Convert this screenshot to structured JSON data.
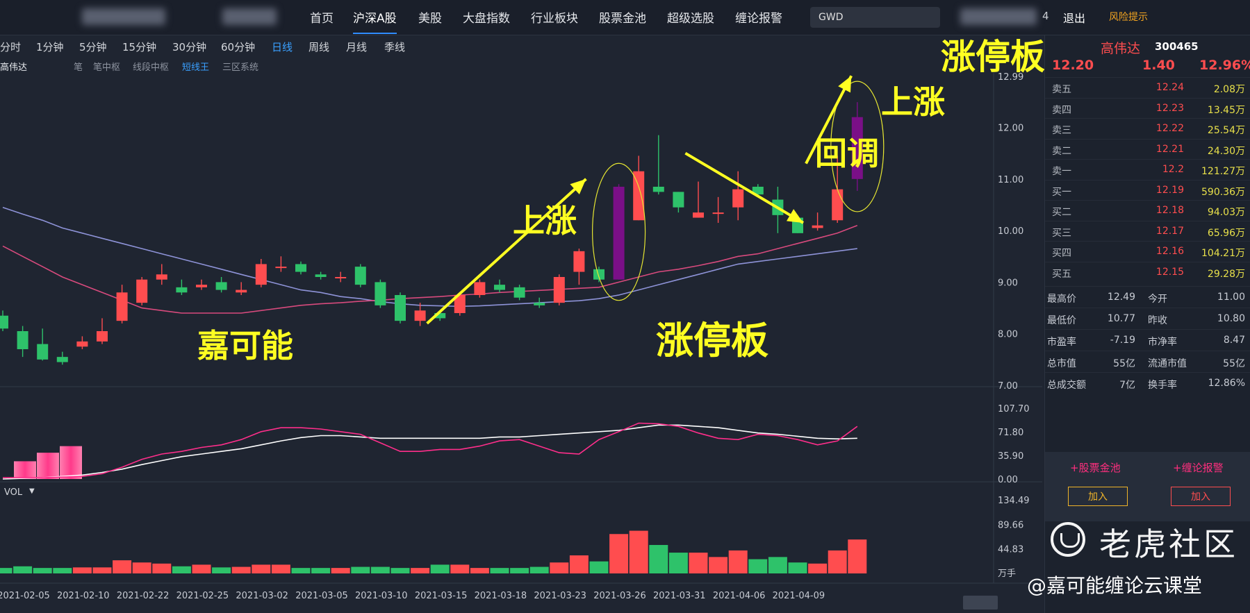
{
  "nav": {
    "items": [
      "首页",
      "沪深A股",
      "美股",
      "大盘指数",
      "行业板块",
      "股票金池",
      "超级选股",
      "缠论报警"
    ],
    "active_index": 1,
    "search_value": "GWD",
    "user_tail": "4",
    "logout": "退出",
    "risk": "风险提示"
  },
  "timeframes": {
    "items": [
      "分时",
      "1分钟",
      "5分钟",
      "15分钟",
      "30分钟",
      "60分钟",
      "日线",
      "周线",
      "月线",
      "季线"
    ],
    "active_index": 6
  },
  "chart_tools": {
    "stock": "高伟达",
    "items": [
      "笔",
      "笔中枢",
      "线段中枢",
      "短线王",
      "三区系统"
    ],
    "active_index": 3
  },
  "annotations": {
    "jiakeneng": "嘉可能",
    "rise1": "上涨",
    "limit_up1": "涨停板",
    "pullback": "回调",
    "rise2": "上涨",
    "limit_up2": "涨停板"
  },
  "vol_label": "VOL",
  "vol_unit": "万手",
  "watermark": {
    "brand": "老虎社区",
    "author": "@嘉可能缠论云课堂"
  },
  "quote": {
    "name": "高伟达",
    "code": "300465",
    "price": "12.20",
    "change": "1.40",
    "change_pct": "12.96%",
    "asks": [
      {
        "label": "卖五",
        "price": "12.24",
        "vol": "2.08万"
      },
      {
        "label": "卖四",
        "price": "12.23",
        "vol": "13.45万"
      },
      {
        "label": "卖三",
        "price": "12.22",
        "vol": "25.54万"
      },
      {
        "label": "卖二",
        "price": "12.21",
        "vol": "24.30万"
      },
      {
        "label": "卖一",
        "price": "12.2",
        "vol": "121.27万"
      }
    ],
    "bids": [
      {
        "label": "买一",
        "price": "12.19",
        "vol": "590.36万"
      },
      {
        "label": "买二",
        "price": "12.18",
        "vol": "94.03万"
      },
      {
        "label": "买三",
        "price": "12.17",
        "vol": "65.96万"
      },
      {
        "label": "买四",
        "price": "12.16",
        "vol": "104.21万"
      },
      {
        "label": "买五",
        "price": "12.15",
        "vol": "29.28万"
      }
    ],
    "stats": [
      [
        "最高价",
        "12.49",
        "今开",
        "11.00"
      ],
      [
        "最低价",
        "10.77",
        "昨收",
        "10.80"
      ],
      [
        "市盈率",
        "-7.19",
        "市净率",
        "8.47"
      ],
      [
        "总市值",
        "55亿",
        "流通市值",
        "55亿"
      ],
      [
        "总成交额",
        "7亿",
        "换手率",
        "12.86%"
      ]
    ],
    "links": [
      "+股票金池",
      "+缠论报警"
    ],
    "add_label": "加入"
  },
  "colors": {
    "up": "#ff4d4f",
    "down": "#2ec26a",
    "limit": "#7a0f87",
    "ma_fast": "#d84a7d",
    "ma_slow": "#8e93d8",
    "macd_fast": "#ff2e8b",
    "macd_slow": "#ffffff",
    "annotation": "#ffff22",
    "bg": "#1f2531"
  },
  "chart_data": {
    "type": "candlestick",
    "price_ticks": [
      "12.99",
      "12.00",
      "11.00",
      "10.00",
      "9.00",
      "8.00",
      "7.00"
    ],
    "price_range": [
      7.0,
      12.99
    ],
    "date_labels": [
      "2021-02-05",
      "2021-02-10",
      "2021-02-22",
      "2021-02-25",
      "2021-03-02",
      "2021-03-05",
      "2021-03-10",
      "2021-03-15",
      "2021-03-18",
      "2021-03-23",
      "2021-03-26",
      "2021-03-31",
      "2021-04-06",
      "2021-04-09"
    ],
    "candles": [
      [
        8.35,
        8.1,
        8.45,
        8.05
      ],
      [
        8.05,
        7.7,
        8.15,
        7.55
      ],
      [
        7.8,
        7.5,
        8.1,
        7.48
      ],
      [
        7.55,
        7.45,
        7.65,
        7.4
      ],
      [
        7.75,
        7.85,
        7.95,
        7.7
      ],
      [
        7.85,
        8.05,
        8.3,
        7.8
      ],
      [
        8.25,
        8.8,
        8.95,
        8.2
      ],
      [
        8.6,
        9.05,
        9.1,
        8.55
      ],
      [
        9.05,
        9.15,
        9.35,
        8.95
      ],
      [
        8.9,
        8.8,
        9.05,
        8.75
      ],
      [
        8.9,
        8.95,
        9.05,
        8.85
      ],
      [
        9.0,
        8.85,
        9.1,
        8.8
      ],
      [
        8.8,
        8.85,
        9.0,
        8.75
      ],
      [
        8.95,
        9.35,
        9.45,
        8.9
      ],
      [
        9.3,
        9.3,
        9.5,
        9.2
      ],
      [
        9.35,
        9.2,
        9.4,
        9.15
      ],
      [
        9.15,
        9.1,
        9.2,
        9.05
      ],
      [
        9.1,
        9.1,
        9.2,
        9.0
      ],
      [
        9.3,
        8.95,
        9.35,
        8.9
      ],
      [
        9.0,
        8.55,
        9.05,
        8.5
      ],
      [
        8.75,
        8.25,
        8.8,
        8.2
      ],
      [
        8.25,
        8.45,
        8.6,
        8.15
      ],
      [
        8.4,
        8.3,
        8.45,
        8.25
      ],
      [
        8.4,
        8.75,
        8.8,
        8.35
      ],
      [
        8.75,
        9.0,
        9.05,
        8.7
      ],
      [
        8.95,
        8.85,
        9.05,
        8.8
      ],
      [
        8.9,
        8.7,
        8.95,
        8.65
      ],
      [
        8.6,
        8.55,
        8.7,
        8.5
      ],
      [
        8.6,
        9.1,
        9.15,
        8.55
      ],
      [
        9.2,
        9.6,
        9.65,
        8.95
      ],
      [
        9.25,
        9.05,
        9.3,
        9.0
      ],
      [
        9.05,
        10.85,
        10.9,
        9.05
      ],
      [
        10.2,
        11.15,
        11.45,
        10.2
      ],
      [
        10.85,
        10.75,
        11.85,
        10.7
      ],
      [
        10.75,
        10.45,
        10.75,
        10.35
      ],
      [
        10.25,
        10.35,
        10.95,
        10.25
      ],
      [
        10.35,
        10.35,
        10.65,
        10.15
      ],
      [
        10.45,
        10.8,
        11.15,
        10.2
      ],
      [
        10.85,
        10.7,
        10.9,
        10.65
      ],
      [
        10.6,
        10.3,
        10.85,
        9.95
      ],
      [
        10.25,
        9.95,
        10.3,
        9.95
      ],
      [
        10.05,
        10.1,
        10.35,
        10.0
      ],
      [
        10.2,
        10.8,
        11.45,
        10.15
      ],
      [
        11.0,
        12.2,
        12.49,
        10.77
      ]
    ],
    "limit_up_indices": [
      31,
      43
    ],
    "ma_fast": [
      9.7,
      9.5,
      9.3,
      9.1,
      8.95,
      8.8,
      8.65,
      8.5,
      8.45,
      8.4,
      8.4,
      8.4,
      8.4,
      8.45,
      8.5,
      8.55,
      8.58,
      8.6,
      8.63,
      8.65,
      8.68,
      8.7,
      8.72,
      8.75,
      8.77,
      8.8,
      8.82,
      8.84,
      8.86,
      8.88,
      8.9,
      9.0,
      9.1,
      9.2,
      9.25,
      9.32,
      9.4,
      9.5,
      9.55,
      9.65,
      9.75,
      9.85,
      9.95,
      10.1
    ],
    "ma_slow": [
      10.45,
      10.32,
      10.2,
      10.05,
      9.95,
      9.85,
      9.75,
      9.65,
      9.55,
      9.45,
      9.35,
      9.25,
      9.15,
      9.05,
      8.95,
      8.85,
      8.8,
      8.72,
      8.68,
      8.62,
      8.58,
      8.55,
      8.54,
      8.53,
      8.54,
      8.56,
      8.58,
      8.6,
      8.62,
      8.64,
      8.68,
      8.75,
      8.85,
      8.95,
      9.05,
      9.15,
      9.25,
      9.35,
      9.4,
      9.45,
      9.5,
      9.55,
      9.6,
      9.65
    ],
    "macd_ticks": [
      "107.70",
      "71.80",
      "35.90",
      "0.00"
    ],
    "macd_range": [
      0,
      107.7
    ],
    "macd_bars": [
      [
        0,
        27
      ],
      [
        1,
        40
      ],
      [
        2,
        50
      ]
    ],
    "macd_fast": [
      2,
      2,
      2,
      3,
      4,
      8,
      18,
      30,
      38,
      42,
      48,
      52,
      60,
      72,
      78,
      78,
      76,
      72,
      68,
      55,
      42,
      42,
      45,
      45,
      50,
      58,
      60,
      50,
      40,
      38,
      60,
      72,
      85,
      84,
      80,
      70,
      62,
      60,
      68,
      66,
      60,
      52,
      58,
      80
    ],
    "macd_slow": [
      0,
      1,
      2,
      4,
      6,
      10,
      15,
      22,
      28,
      34,
      38,
      42,
      46,
      52,
      58,
      63,
      66,
      66,
      64,
      62,
      62,
      62,
      62,
      62,
      62,
      64,
      64,
      66,
      68,
      70,
      72,
      74,
      78,
      82,
      82,
      80,
      78,
      74,
      70,
      68,
      65,
      62,
      61,
      62
    ],
    "vol_ticks": [
      "134.49",
      "89.66",
      "44.83"
    ],
    "vol_range": [
      0,
      134.49
    ],
    "volumes": [
      10,
      13,
      10,
      10,
      11,
      11,
      24,
      20,
      18,
      13,
      16,
      11,
      12,
      16,
      16,
      10,
      10,
      10,
      12,
      12,
      10,
      10,
      16,
      16,
      10,
      10,
      10,
      12,
      20,
      33,
      22,
      72,
      78,
      52,
      38,
      38,
      30,
      42,
      26,
      30,
      20,
      18,
      42,
      62
    ]
  }
}
